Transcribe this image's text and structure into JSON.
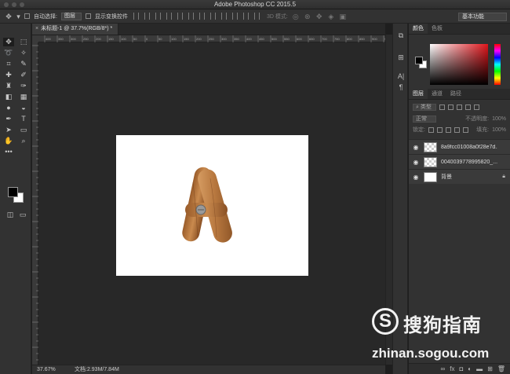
{
  "titlebar": {
    "title": "Adobe Photoshop CC 2015.5"
  },
  "options": {
    "move_icon": "move-tool-icon",
    "auto_select_label": "自动选择:",
    "auto_select_value": "图层",
    "show_transform_label": "显示变换控件",
    "mode_3d_label": "3D 模式:",
    "workspace_value": "基本功能"
  },
  "document": {
    "tab_title": "未标题-1 @ 37.7%(RGB/8*) *",
    "ruler_ticks": [
      "400",
      "350",
      "300",
      "250",
      "200",
      "150",
      "100",
      "50",
      "0",
      "50",
      "100",
      "150",
      "200",
      "250",
      "300",
      "350",
      "400",
      "450",
      "500",
      "550",
      "600",
      "650",
      "700",
      "750",
      "800",
      "850",
      "900",
      "950"
    ],
    "image_label": "A"
  },
  "status": {
    "zoom": "37.67%",
    "doc_size": "文档:2.93M/7.84M"
  },
  "panels": {
    "color_tabs": [
      "颜色",
      "色板"
    ],
    "layer_tabs": [
      "图层",
      "通道",
      "路径"
    ],
    "kind_filter": "类型",
    "blend_mode": "正常",
    "opacity_label": "不透明度:",
    "opacity_value": "100%",
    "lock_label": "锁定:",
    "fill_label": "填充:",
    "fill_value": "100%",
    "layers": [
      {
        "name": "8a9fcc01008a0f28e7d...",
        "thumb": "checker"
      },
      {
        "name": "004003977899582​0_...",
        "thumb": "checker"
      },
      {
        "name": "背景",
        "thumb": "white"
      }
    ]
  },
  "watermark": {
    "logo": "S",
    "brand": "搜狗指南",
    "url": "zhinan.sogou.com"
  }
}
